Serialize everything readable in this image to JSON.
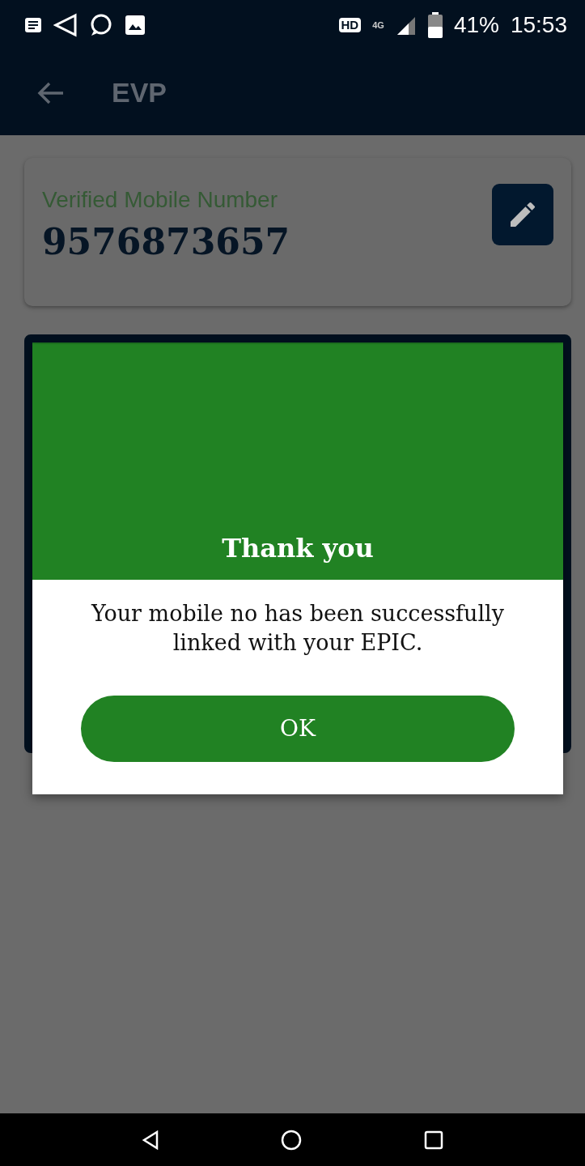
{
  "status_bar": {
    "battery": "41%",
    "time": "15:53",
    "network": "4G",
    "hd": "HD"
  },
  "app_bar": {
    "title": "EVP"
  },
  "mobile_card": {
    "label": "Verified Mobile Number",
    "number": "9576873657"
  },
  "dialog": {
    "title": "Thank you",
    "message": "Your mobile no has been successfully linked with your EPIC.",
    "button": "OK"
  }
}
